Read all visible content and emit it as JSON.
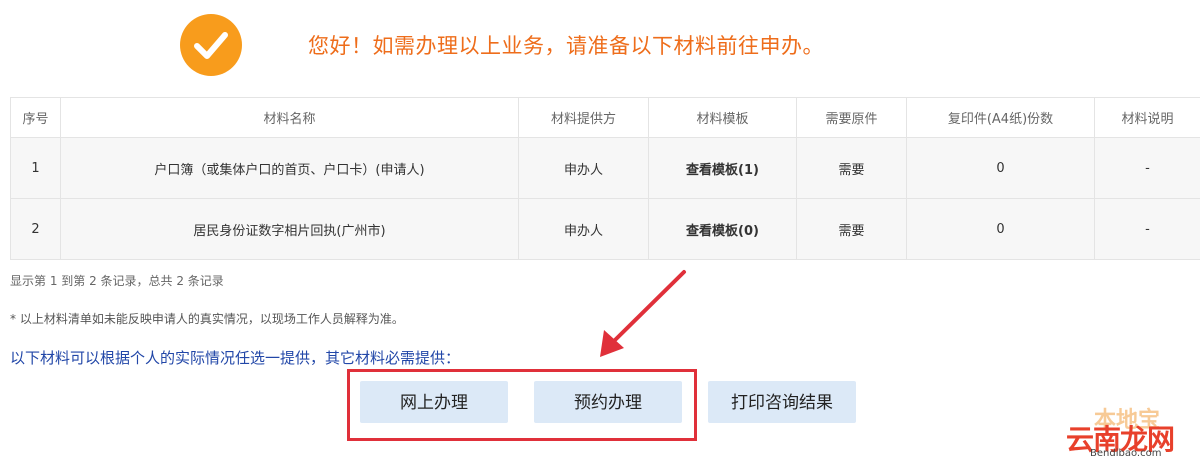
{
  "header": {
    "message": "您好！如需办理以上业务，请准备以下材料前往申办。"
  },
  "table": {
    "columns": [
      "序号",
      "材料名称",
      "材料提供方",
      "材料模板",
      "需要原件",
      "复印件(A4纸)份数",
      "材料说明"
    ],
    "rows": [
      {
        "index": "1",
        "name": "户口簿（或集体户口的首页、户口卡）(申请人)",
        "provider": "申办人",
        "template": "查看模板(1)",
        "original": "需要",
        "copies": "0",
        "note": "-"
      },
      {
        "index": "2",
        "name": "居民身份证数字相片回执(广州市)",
        "provider": "申办人",
        "template": "查看模板(0)",
        "original": "需要",
        "copies": "0",
        "note": "-"
      }
    ]
  },
  "records_text": "显示第 1 到第 2 条记录，总共 2 条记录",
  "disclaimer": "* 以上材料清单如未能反映申请人的真实情况，以现场工作人员解释为准。",
  "optional_text": "以下材料可以根据个人的实际情况任选一提供，其它材料必需提供：",
  "buttons": {
    "online": "网上办理",
    "appointment": "预约办理",
    "print": "打印咨询结果"
  },
  "watermark": {
    "top": "本地宝",
    "main": "云南龙网",
    "sub": "Bendibao.com"
  },
  "colors": {
    "accent_orange": "#f89c1c",
    "headline_orange": "#ee6d1b",
    "link_blue": "#2247a8",
    "button_bg": "#dce9f7",
    "highlight_red": "#e0303a"
  },
  "icons": [
    "check-circle-icon",
    "red-arrow-icon"
  ]
}
